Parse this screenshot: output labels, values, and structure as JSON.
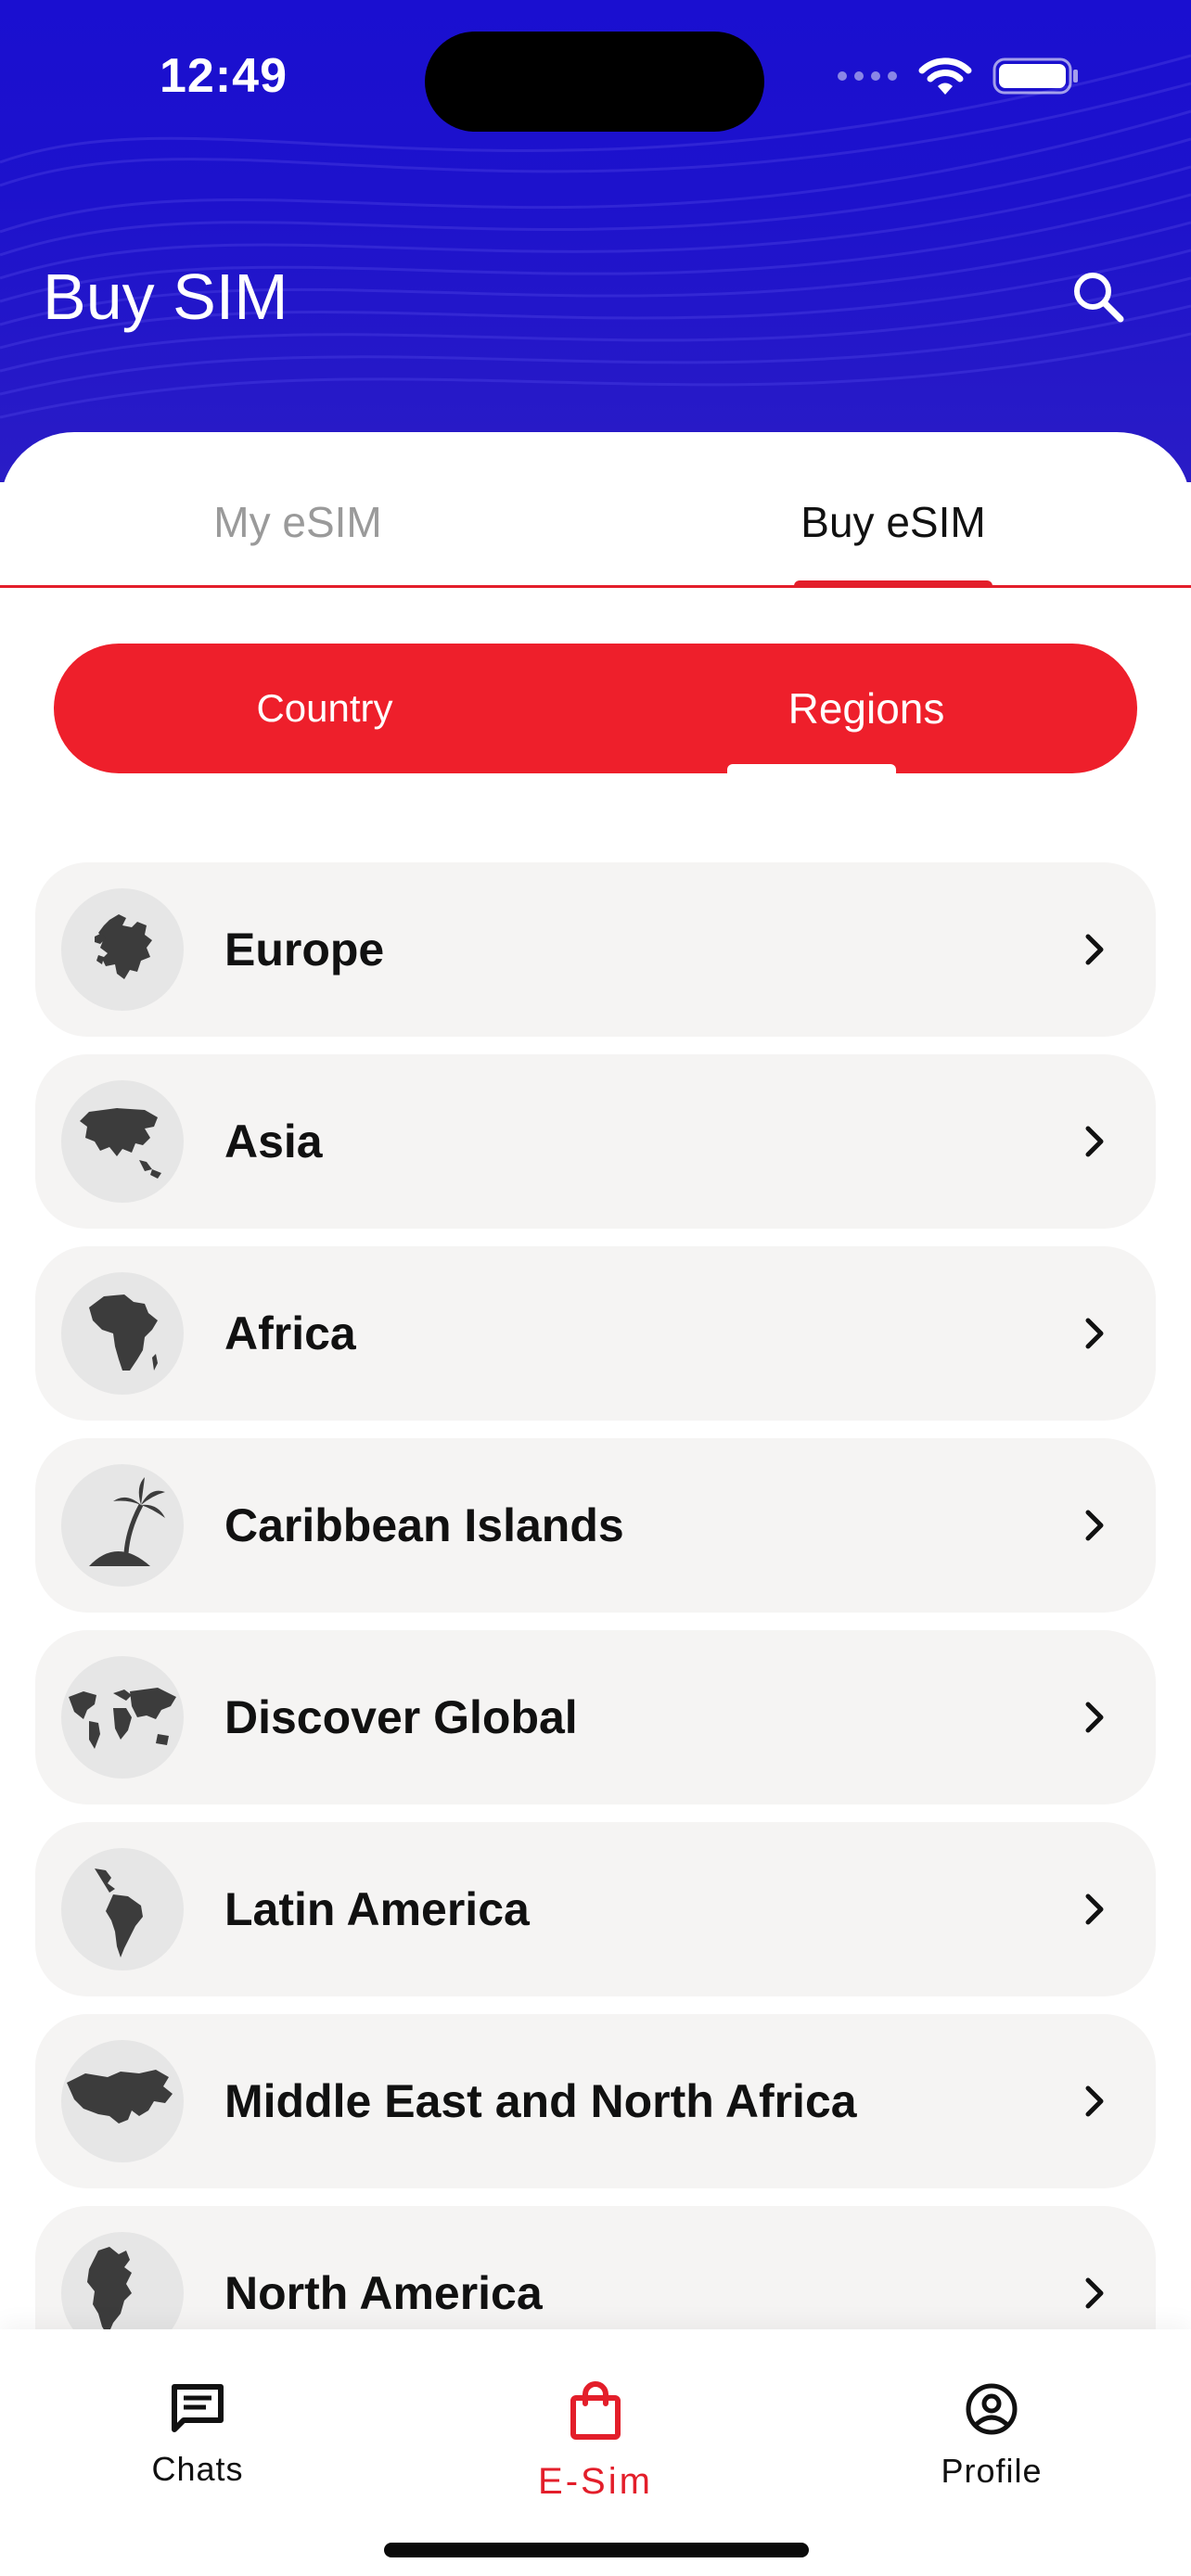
{
  "status_bar": {
    "time": "12:49"
  },
  "header": {
    "title": "Buy SIM"
  },
  "tabs": [
    {
      "label": "My eSIM",
      "active": false
    },
    {
      "label": "Buy eSIM",
      "active": true
    }
  ],
  "segment": {
    "country_label": "Country",
    "regions_label": "Regions",
    "selected": "Regions"
  },
  "regions": [
    {
      "label": "Europe",
      "icon": "europe-map-icon"
    },
    {
      "label": "Asia",
      "icon": "asia-map-icon"
    },
    {
      "label": "Africa",
      "icon": "africa-map-icon"
    },
    {
      "label": "Caribbean Islands",
      "icon": "palm-island-icon"
    },
    {
      "label": "Discover Global",
      "icon": "world-map-icon"
    },
    {
      "label": "Latin America",
      "icon": "latin-america-map-icon"
    },
    {
      "label": "Middle East and North Africa",
      "icon": "mena-map-icon"
    },
    {
      "label": "North America",
      "icon": "north-america-map-icon"
    }
  ],
  "bottom_nav": [
    {
      "label": "Chats",
      "icon": "chat-icon",
      "active": false
    },
    {
      "label": "E-Sim",
      "icon": "shopping-bag-icon",
      "active": true
    },
    {
      "label": "Profile",
      "icon": "profile-icon",
      "active": false
    }
  ],
  "colors": {
    "header_blue": "#1d12cc",
    "accent_red": "#e31e2a",
    "row_bg": "#f5f4f3"
  }
}
